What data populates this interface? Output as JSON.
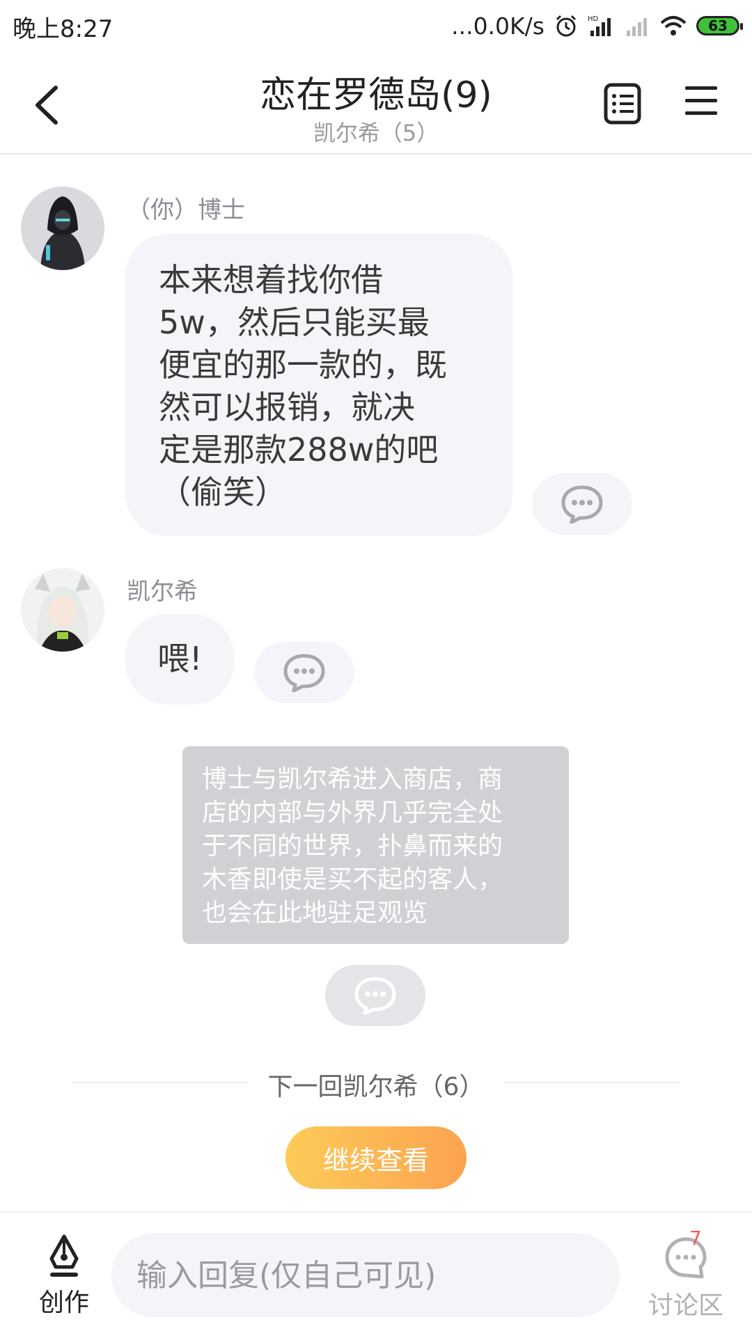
{
  "status_bar": {
    "time": "晚上8:27",
    "net_speed": "...0.0K/s",
    "battery_level": "63"
  },
  "header": {
    "title": "恋在罗德岛(9)",
    "subtitle": "凯尔希（5）"
  },
  "messages": [
    {
      "sender": "（你）博士",
      "lines": [
        "本来想着找你借",
        "5w，然后只能买最",
        "便宜的那一款的，既",
        "然可以报销，就决",
        "定是那款288w的吧",
        "（偷笑）"
      ]
    },
    {
      "sender": "凯尔希",
      "lines": [
        "喂!"
      ]
    }
  ],
  "narration": {
    "lines": [
      "博士与凯尔希进入商店，商",
      "店的内部与外界几乎完全处",
      "于不同的世界，扑鼻而来的",
      "木香即使是买不起的客人，",
      "也会在此地驻足观览"
    ]
  },
  "next_chapter": {
    "label": "下一回凯尔希（6）",
    "continue_label": "继续查看"
  },
  "bottom_bar": {
    "create_label": "创作",
    "input_placeholder": "输入回复(仅自己可见)",
    "discuss_label": "讨论区",
    "discuss_count": "7"
  },
  "colors": {
    "accent_start": "#fdcb58",
    "accent_end": "#fba350",
    "bubble_bg": "#f4f5f8",
    "narration_bg": "#d0d1d5",
    "badge": "#f25c4a"
  }
}
